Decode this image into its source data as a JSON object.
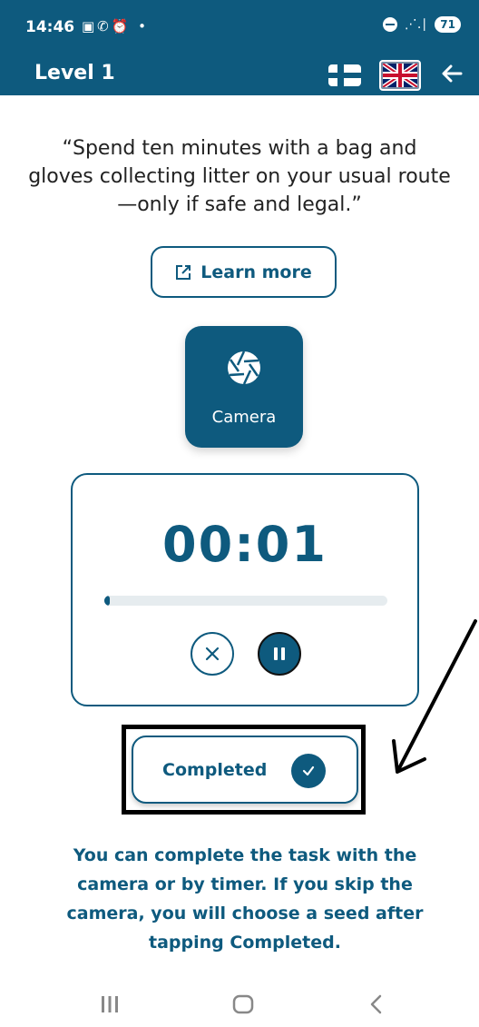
{
  "status_bar": {
    "time": "14:46",
    "left_icons": "▣✆⏰ •",
    "signal": "⋰.∣",
    "battery": "71"
  },
  "app_bar": {
    "title": "Level 1",
    "languages": [
      "finnish-flag",
      "uk-flag"
    ],
    "back_icon": "arrow-left-icon"
  },
  "task": {
    "quote": "“Spend ten minutes with a bag and gloves collecting litter on your usual route—only if safe and legal.”",
    "learn_more_label": "Learn more",
    "camera_label": "Camera"
  },
  "timer": {
    "value": "00:01",
    "progress": 0.01
  },
  "completed": {
    "label": "Completed"
  },
  "hint": "You can complete the task with the camera or by timer. If you skip the camera, you will choose a seed after tapping Completed.",
  "colors": {
    "primary": "#0e5a7e",
    "track": "#e6ecef",
    "annotation": "#000000"
  },
  "nav": {
    "icons": [
      "recent-apps-icon",
      "home-icon",
      "back-icon"
    ]
  }
}
